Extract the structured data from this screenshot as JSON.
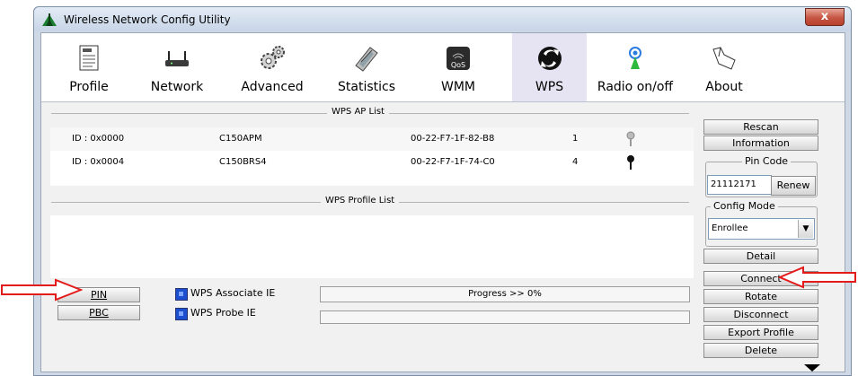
{
  "window": {
    "title": "Wireless Network Config Utility",
    "close_glyph": "x"
  },
  "toolbar": {
    "items": [
      {
        "label": "Profile",
        "icon": "profile-icon"
      },
      {
        "label": "Network",
        "icon": "network-icon"
      },
      {
        "label": "Advanced",
        "icon": "advanced-gears-icon"
      },
      {
        "label": "Statistics",
        "icon": "statistics-icon"
      },
      {
        "label": "WMM",
        "icon": "wmm-qos-icon"
      },
      {
        "label": "WPS",
        "icon": "wps-icon"
      },
      {
        "label": "Radio on/off",
        "icon": "radio-icon"
      },
      {
        "label": "About",
        "icon": "about-icon"
      }
    ],
    "active": "WPS"
  },
  "ap_list": {
    "title": "WPS AP List",
    "rows": [
      {
        "id": "ID : 0x0000",
        "ssid": "C150APM",
        "bssid": "00-22-F7-1F-82-B8",
        "channel": "1",
        "key_icon": "key-gray-icon"
      },
      {
        "id": "ID : 0x0004",
        "ssid": "C150BRS4",
        "bssid": "00-22-F7-1F-74-C0",
        "channel": "4",
        "key_icon": "key-black-icon"
      }
    ]
  },
  "profile_list": {
    "title": "WPS Profile List"
  },
  "side": {
    "rescan": "Rescan",
    "information": "Information",
    "pin_code_legend": "Pin Code",
    "pin_code_value": "21112171",
    "renew": "Renew",
    "config_mode_legend": "Config Mode",
    "config_mode_value": "Enrollee",
    "detail": "Detail",
    "connect": "Connect",
    "rotate": "Rotate",
    "disconnect": "Disconnect",
    "export_profile": "Export Profile",
    "delete": "Delete"
  },
  "bottom": {
    "pin": "PIN",
    "pbc": "PBC",
    "wps_associate_ie": "WPS Associate IE",
    "wps_probe_ie": "WPS Probe IE",
    "progress_text": "Progress >> 0%",
    "progress_value": 0
  },
  "colors": {
    "annotation_arrow": "#e31b1b",
    "active_tab_bg": "#e6e4f2",
    "checkbox": "#1b4fcf"
  }
}
